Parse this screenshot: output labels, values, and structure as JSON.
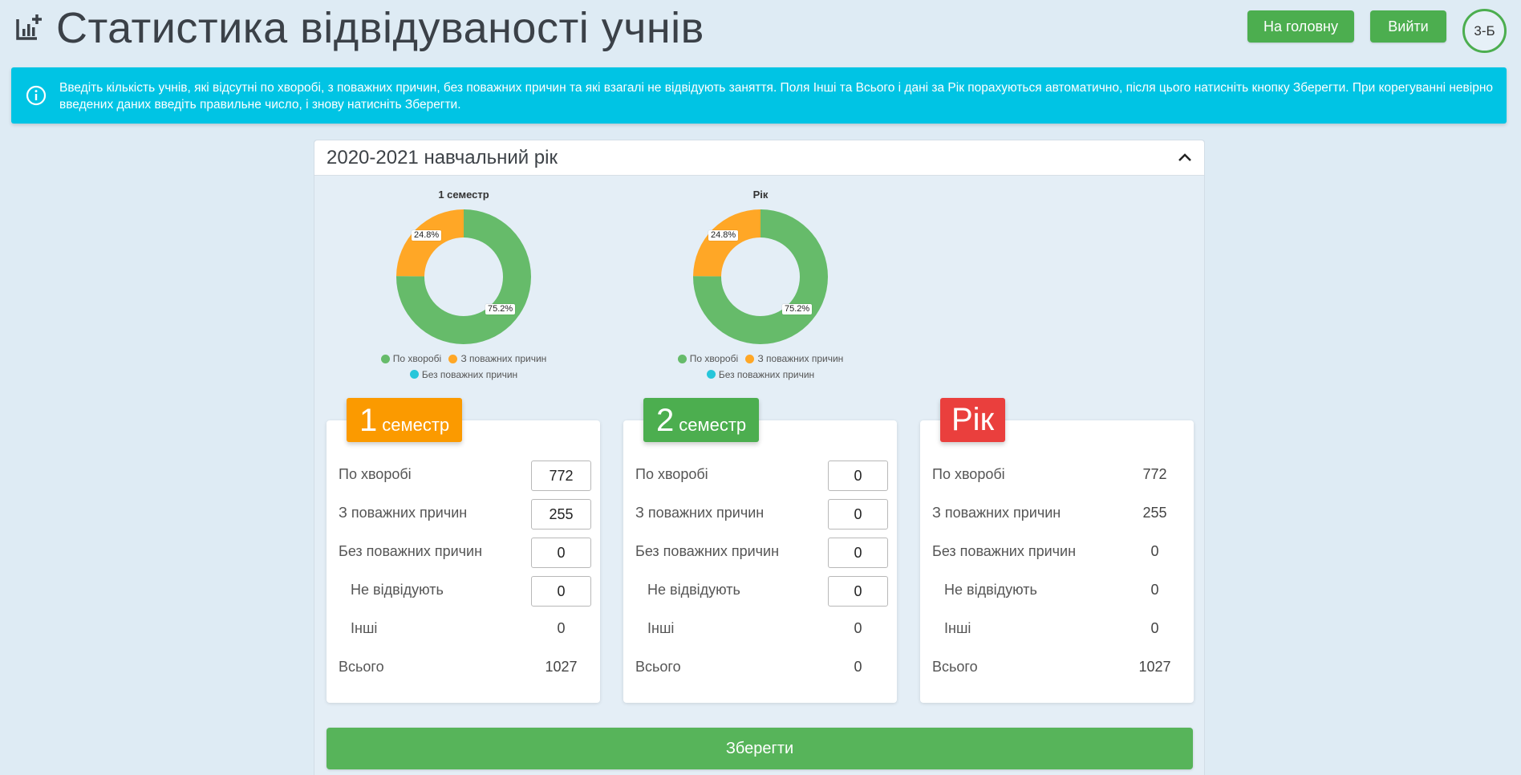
{
  "header": {
    "title": "Статистика відвідуваності учнів",
    "home_label": "На головну",
    "exit_label": "Вийти",
    "class_badge": "3-Б"
  },
  "info": {
    "text": "Введіть кількість учнів, які відсутні по хворобі, з поважних причин, без поважних причин та які взагалі не відвідують заняття. Поля Інші та Всього і дані за Рік порахуються автоматично, після цього натисніть кнопку Зберегти. При корегуванні невірно введених даних введіть правильне число, і знову натисніть Зберегти."
  },
  "panel": {
    "title": "2020-2021 навчальний рік"
  },
  "legend": {
    "illness": "По хворобі",
    "excused": "З поважних причин",
    "unexcused": "Без поважних причин"
  },
  "colors": {
    "illness": "#66bb6a",
    "excused": "#ffa726",
    "unexcused": "#26c6da"
  },
  "chart_data": [
    {
      "type": "pie",
      "title": "1 семестр",
      "categories": [
        "По хворобі",
        "З поважних причин",
        "Без поважних причин"
      ],
      "values": [
        772,
        255,
        0
      ],
      "labels": [
        "75.2%",
        "24.8%"
      ]
    },
    {
      "type": "pie",
      "title": "Рік",
      "categories": [
        "По хворобі",
        "З поважних причин",
        "Без поважних причин"
      ],
      "values": [
        772,
        255,
        0
      ],
      "labels": [
        "75.2%",
        "24.8%"
      ]
    }
  ],
  "cards": {
    "s1": {
      "num": "1",
      "word": "семестр",
      "illness": "772",
      "excused": "255",
      "unexcused": "0",
      "absent": "0",
      "other": "0",
      "total": "1027"
    },
    "s2": {
      "num": "2",
      "word": "семестр",
      "illness": "0",
      "excused": "0",
      "unexcused": "0",
      "absent": "0",
      "other": "0",
      "total": "0"
    },
    "year": {
      "word": "Рік",
      "illness": "772",
      "excused": "255",
      "unexcused": "0",
      "absent": "0",
      "other": "0",
      "total": "1027"
    }
  },
  "row_labels": {
    "illness": "По хворобі",
    "excused": "З поважних причин",
    "unexcused": "Без поважних причин",
    "absent": "Не відвідують",
    "other": "Інші",
    "total": "Всього"
  },
  "save_label": "Зберегти"
}
